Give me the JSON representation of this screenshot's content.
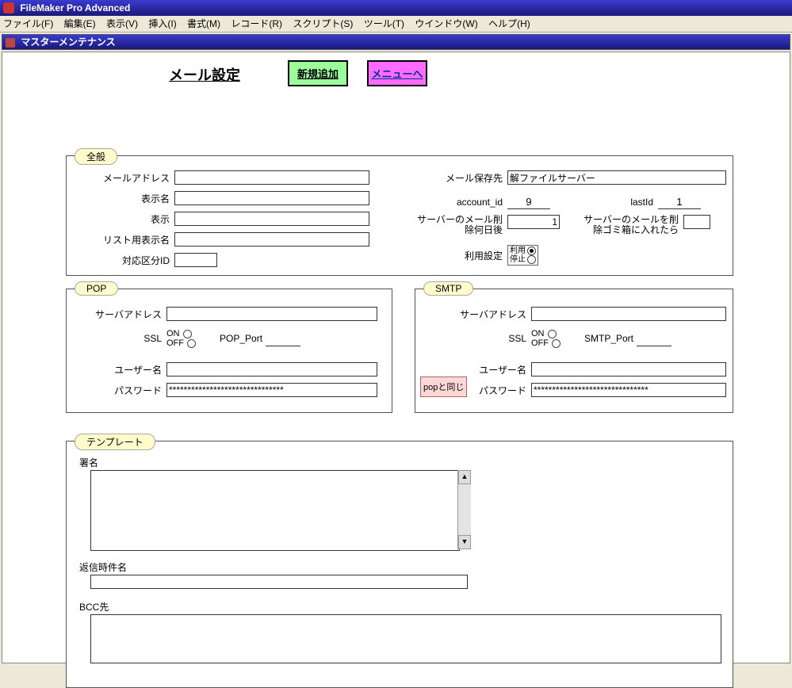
{
  "app_title": "FileMaker Pro Advanced",
  "menus": [
    "ファイル(F)",
    "編集(E)",
    "表示(V)",
    "挿入(I)",
    "書式(M)",
    "レコード(R)",
    "スクリプト(S)",
    "ツール(T)",
    "ウインドウ(W)",
    "ヘルプ(H)"
  ],
  "window_title": "マスターメンテナンス",
  "page_heading": "メール設定",
  "btn_new": "新規追加",
  "btn_menu": "メニューへ",
  "general": {
    "legend": "全般",
    "mail_address_label": "メールアドレス",
    "mail_address": "",
    "display_name_label": "表示名",
    "display_name": "",
    "display_label": "表示",
    "display": "",
    "list_display_name_label": "リスト用表示名",
    "list_display_name": "",
    "taiou_id_label": "対応区分ID",
    "taiou_id": "",
    "mail_save_label": "メール保存先",
    "mail_save_value": "解ファイルサーバー",
    "account_id_label": "account_id",
    "account_id": "9",
    "lastid_label": "lastId",
    "lastid": "1",
    "server_delete_days_label": "サーバーのメール削除何日後",
    "server_delete_days": "1",
    "server_delete_trash_label": "サーバーのメールを削除ゴミ箱に入れたら",
    "server_delete_trash": "",
    "usage_label": "利用設定",
    "usage_on": "利用",
    "usage_off": "停止",
    "usage_value": "on"
  },
  "pop": {
    "legend": "POP",
    "server_label": "サーバアドレス",
    "server": "",
    "ssl_label": "SSL",
    "ssl_on": "ON",
    "ssl_off": "OFF",
    "ssl_value": "",
    "port_label": "POP_Port",
    "port": "",
    "user_label": "ユーザー名",
    "user": "",
    "pass_label": "パスワード",
    "pass": "*******************************"
  },
  "smtp": {
    "legend": "SMTP",
    "server_label": "サーバアドレス",
    "server": "",
    "ssl_label": "SSL",
    "ssl_on": "ON",
    "ssl_off": "OFF",
    "ssl_value": "",
    "port_label": "SMTP_Port",
    "port": "",
    "user_label": "ユーザー名",
    "user": "",
    "pass_label": "パスワード",
    "pass": "*******************************",
    "popsame": "popと同じ"
  },
  "template": {
    "legend": "テンプレート",
    "signature_label": "署名",
    "signature": "",
    "reply_subject_label": "返信時件名",
    "reply_subject": "",
    "bcc_label": "BCC先",
    "bcc": ""
  }
}
